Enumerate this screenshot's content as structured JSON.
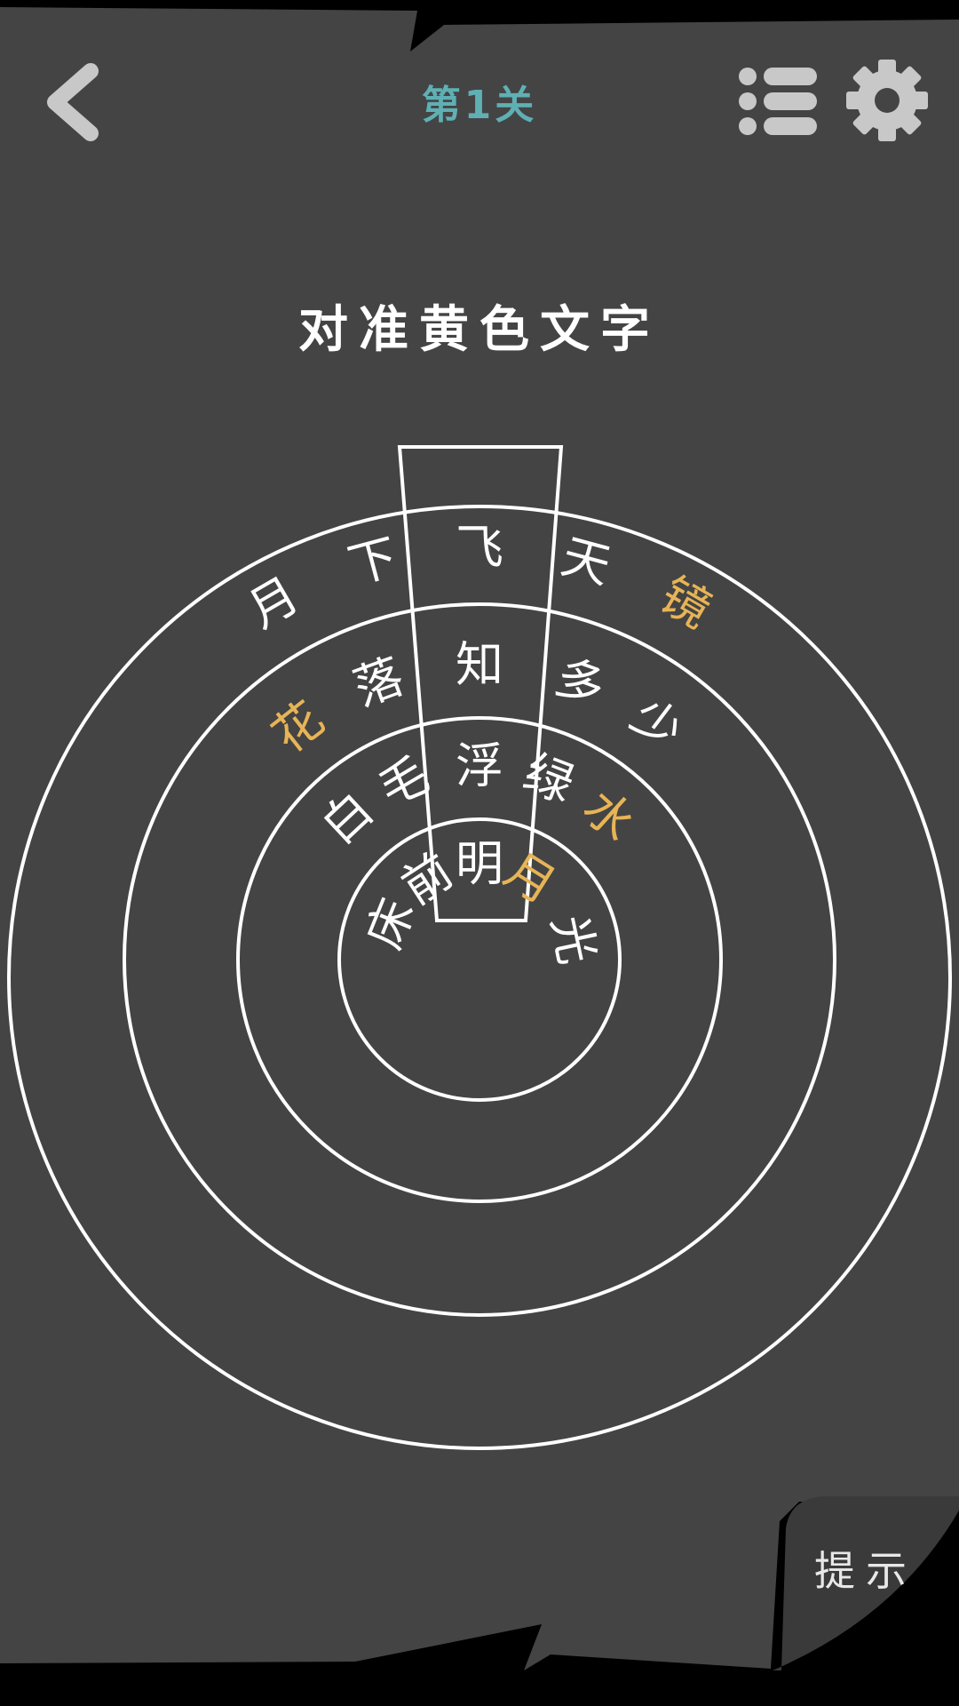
{
  "header": {
    "level_title": "第1关",
    "back_icon": "chevron-left-icon",
    "list_icon": "list-icon",
    "settings_icon": "gear-icon"
  },
  "instruction": "对准黄色文字",
  "hint_label": "提示",
  "colors": {
    "board": "#444444",
    "frame": "#000000",
    "text": "#ffffff",
    "highlight": "#e7b456",
    "title": "#5fb0b4",
    "icon": "#c8c8c8"
  },
  "rings": [
    {
      "name": "inner",
      "chars": [
        {
          "char": "床",
          "angle_deg": -68,
          "highlight": false
        },
        {
          "char": "前",
          "angle_deg": -33,
          "highlight": false
        },
        {
          "char": "明",
          "angle_deg": 0,
          "highlight": false
        },
        {
          "char": "月",
          "angle_deg": 32,
          "highlight": true
        },
        {
          "char": "光",
          "angle_deg": 78,
          "highlight": false
        }
      ]
    },
    {
      "name": "second",
      "chars": [
        {
          "char": "白",
          "angle_deg": -43,
          "highlight": false
        },
        {
          "char": "毛",
          "angle_deg": -23,
          "highlight": false
        },
        {
          "char": "浮",
          "angle_deg": 0,
          "highlight": false
        },
        {
          "char": "绿",
          "angle_deg": 21,
          "highlight": false
        },
        {
          "char": "水",
          "angle_deg": 42,
          "highlight": true
        }
      ]
    },
    {
      "name": "third",
      "chars": [
        {
          "char": "花",
          "angle_deg": -38,
          "highlight": true
        },
        {
          "char": "落",
          "angle_deg": -20,
          "highlight": false
        },
        {
          "char": "知",
          "angle_deg": 0,
          "highlight": false
        },
        {
          "char": "多",
          "angle_deg": 20,
          "highlight": false
        },
        {
          "char": "少",
          "angle_deg": 37,
          "highlight": false
        }
      ]
    },
    {
      "name": "outer",
      "chars": [
        {
          "char": "月",
          "angle_deg": -30,
          "highlight": false
        },
        {
          "char": "下",
          "angle_deg": -15,
          "highlight": false
        },
        {
          "char": "飞",
          "angle_deg": 0,
          "highlight": false
        },
        {
          "char": "天",
          "angle_deg": 15,
          "highlight": false
        },
        {
          "char": "镜",
          "angle_deg": 30,
          "highlight": true
        }
      ]
    }
  ]
}
